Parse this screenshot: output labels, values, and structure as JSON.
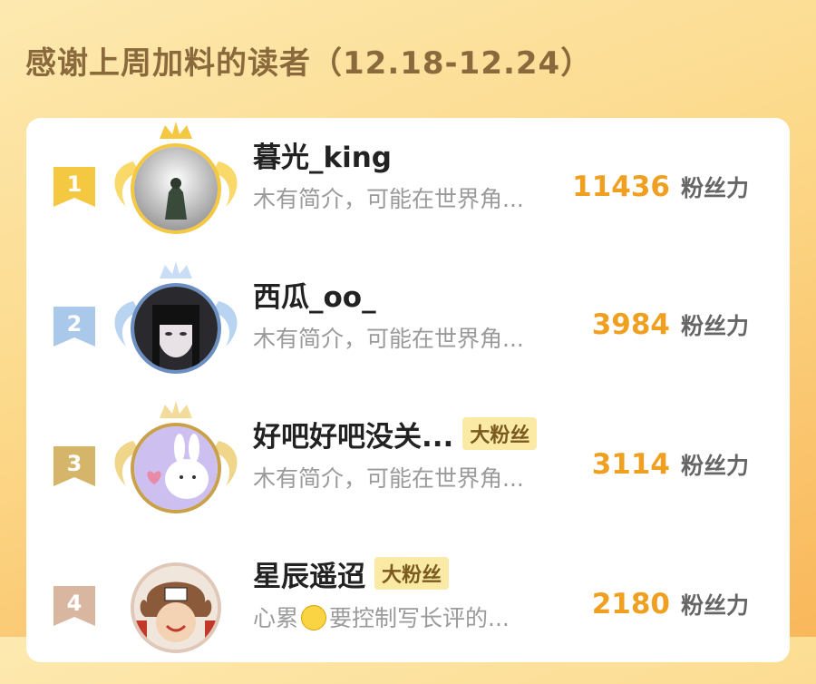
{
  "header": {
    "title": "感谢上周加料的读者（12.18-12.24）"
  },
  "colors": {
    "gold": "#f5c842",
    "silver": "#a9c8ea",
    "bronze": "#d4b56a",
    "rank4": "#d9b6a0",
    "score": "#f0a020"
  },
  "readers": [
    {
      "rank": "1",
      "name": "暮光_king",
      "tag": "",
      "bio": "木有简介，可能在世界角...",
      "score": "11436",
      "unit": "粉丝力"
    },
    {
      "rank": "2",
      "name": "西瓜_oo_",
      "tag": "",
      "bio": "木有简介，可能在世界角...",
      "score": "3984",
      "unit": "粉丝力"
    },
    {
      "rank": "3",
      "name": "好吧好吧没关...",
      "tag": "大粉丝",
      "bio": "木有简介，可能在世界角...",
      "score": "3114",
      "unit": "粉丝力"
    },
    {
      "rank": "4",
      "name": "星辰遥迢",
      "tag": "大粉丝",
      "bio_before": "心累",
      "bio_after": "要控制写长评的...",
      "score": "2180",
      "unit": "粉丝力"
    }
  ]
}
